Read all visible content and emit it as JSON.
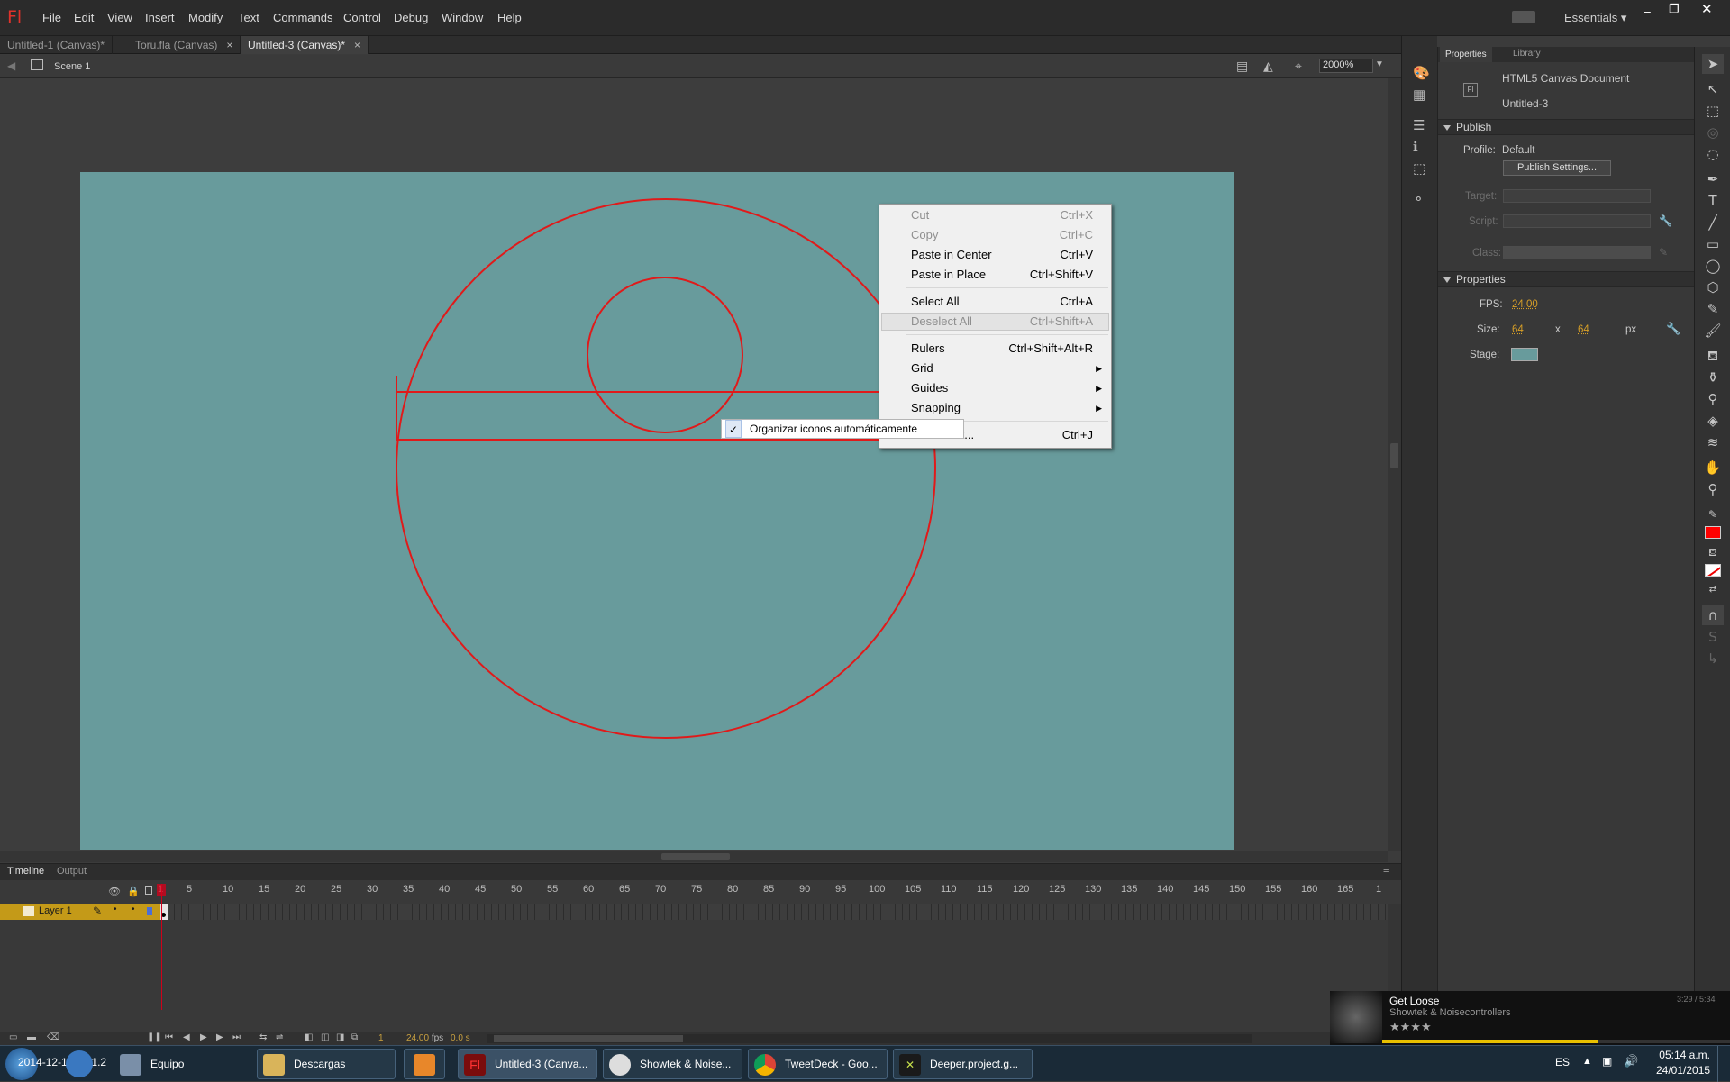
{
  "app": {
    "logo": "Fl",
    "workspace": "Essentials"
  },
  "menu": [
    "File",
    "Edit",
    "View",
    "Insert",
    "Modify",
    "Text",
    "Commands",
    "Control",
    "Debug",
    "Window",
    "Help"
  ],
  "tabs": [
    {
      "label": "Untitled-1 (Canvas)*"
    },
    {
      "label": "Toru.fla (Canvas)"
    },
    {
      "label": "Untitled-3 (Canvas)*"
    }
  ],
  "editbar": {
    "scene": "Scene 1",
    "zoom": "2000%"
  },
  "context_menu": {
    "items": [
      {
        "label": "Cut",
        "shortcut": "Ctrl+X",
        "enabled": false
      },
      {
        "label": "Copy",
        "shortcut": "Ctrl+C",
        "enabled": false
      },
      {
        "label": "Paste in Center",
        "shortcut": "Ctrl+V",
        "enabled": true
      },
      {
        "label": "Paste in Place",
        "shortcut": "Ctrl+Shift+V",
        "enabled": true
      },
      {
        "label": "Select All",
        "shortcut": "Ctrl+A",
        "enabled": true
      },
      {
        "label": "Deselect All",
        "shortcut": "Ctrl+Shift+A",
        "enabled": false
      },
      {
        "label": "Rulers",
        "shortcut": "Ctrl+Shift+Alt+R",
        "enabled": true
      },
      {
        "label": "Grid",
        "shortcut": "",
        "submenu": true
      },
      {
        "label": "Guides",
        "shortcut": "",
        "submenu": true
      },
      {
        "label": "Snapping",
        "shortcut": "",
        "submenu": true
      },
      {
        "label": "Document...",
        "shortcut": "Ctrl+J",
        "enabled": true
      }
    ]
  },
  "tooltip_menu": {
    "label": "Organizar iconos automáticamente",
    "checked": true,
    "check": "✓"
  },
  "timeline": {
    "tabs": [
      "Timeline",
      "Output"
    ],
    "layer": "Layer 1",
    "ruler": [
      "1",
      "5",
      "10",
      "15",
      "20",
      "25",
      "30",
      "35",
      "40",
      "45",
      "50",
      "55",
      "60",
      "65",
      "70",
      "75",
      "80",
      "85",
      "90",
      "95",
      "100",
      "105",
      "110",
      "115",
      "120",
      "125",
      "130",
      "135",
      "140",
      "145",
      "150",
      "155",
      "160",
      "165",
      "1"
    ],
    "footer": {
      "frame": "1",
      "fps": "24.00",
      "fps_unit": "fps",
      "time": "0.0 s"
    }
  },
  "properties": {
    "tabs": [
      "Properties",
      "Library"
    ],
    "doc_type": "HTML5 Canvas Document",
    "doc_name": "Untitled-3",
    "doc_icon_text": "Fl",
    "publish_header": "Publish",
    "profile_label": "Profile:",
    "profile_value": "Default",
    "publish_settings": "Publish Settings...",
    "target_label": "Target:",
    "script_label": "Script:",
    "class_label": "Class:",
    "props_header": "Properties",
    "fps_label": "FPS:",
    "fps_value": "24.00",
    "size_label": "Size:",
    "width": "64",
    "x": "x",
    "height": "64",
    "unit": "px",
    "stage_label": "Stage:",
    "stage_color": "#689b9c"
  },
  "colors": {
    "stroke": "#ff0000",
    "stage": "#689b9c",
    "accent": "#c49a18"
  },
  "now_playing": {
    "title": "Get Loose",
    "artist": "Showtek & Noisecontrollers",
    "time": "3:29 / 5:34",
    "rating": "★★★★"
  },
  "taskbar": {
    "items": [
      {
        "label": "Equipo"
      },
      {
        "label": "Descargas"
      },
      {
        "label": ""
      },
      {
        "label": "Untitled-3 (Canva..."
      },
      {
        "label": "Showtek & Noise..."
      },
      {
        "label": "TweetDeck - Goo..."
      },
      {
        "label": "Deeper.project.g..."
      }
    ],
    "lang": "ES",
    "time": "05:14 a.m.",
    "date": "24/01/2015",
    "overlay": "2014-12-10  40.1.2"
  }
}
